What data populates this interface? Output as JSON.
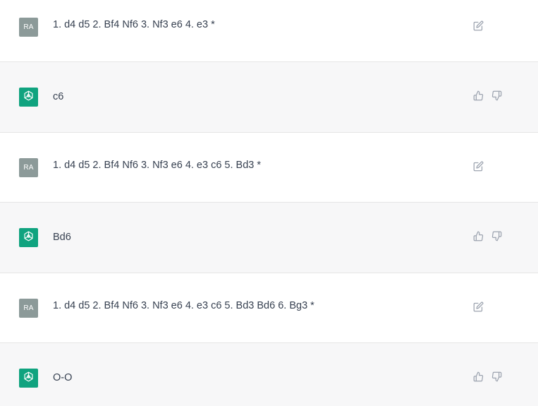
{
  "messages": [
    {
      "role": "user",
      "avatar_initials": "RA",
      "text": "1. d4 d5 2. Bf4 Nf6 3. Nf3 e6 4. e3 *"
    },
    {
      "role": "assistant",
      "text": "c6"
    },
    {
      "role": "user",
      "avatar_initials": "RA",
      "text": "1. d4 d5 2. Bf4 Nf6 3. Nf3 e6 4. e3 c6 5. Bd3 *"
    },
    {
      "role": "assistant",
      "text": "Bd6"
    },
    {
      "role": "user",
      "avatar_initials": "RA",
      "text": "1. d4 d5 2. Bf4 Nf6 3. Nf3 e6 4. e3 c6 5. Bd3 Bd6 6. Bg3 *"
    },
    {
      "role": "assistant",
      "text": "O-O"
    }
  ],
  "icons": {
    "user_action": "edit-icon",
    "assistant_actions": [
      "thumbs-up-icon",
      "thumbs-down-icon"
    ]
  },
  "colors": {
    "assistant_avatar_bg": "#10a37f",
    "user_avatar_bg": "#8c9a99",
    "assistant_row_bg": "#f7f7f8"
  }
}
